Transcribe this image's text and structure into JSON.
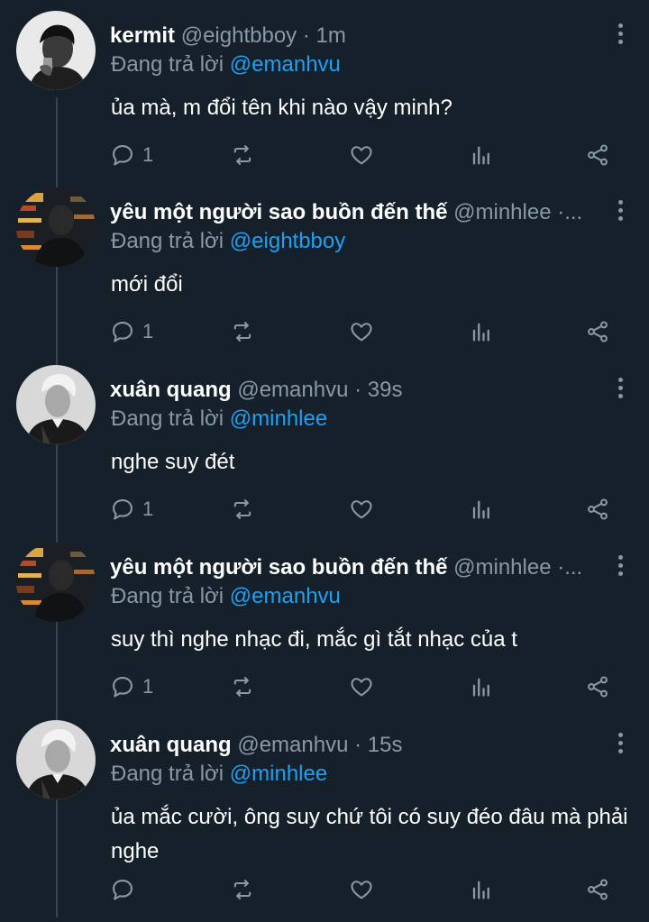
{
  "colors": {
    "background": "#15202b",
    "secondary_text": "#8899a6",
    "mention": "#1da1f2",
    "thread_line": "#38444d"
  },
  "replying_prefix": "Đang trả lời",
  "tweets": [
    {
      "name": "kermit",
      "handle": "@eightbboy",
      "time": "· 1m",
      "reply_to": "@emanhvu",
      "text": "ủa mà, m đổi tên khi nào vậy minh?",
      "reply_count": "1",
      "avatar_icon": "profile-photo-man-drinking"
    },
    {
      "name": "yêu một người sao buồn đến thế",
      "handle": "@minhlee",
      "time": "·...",
      "reply_to": "@eightbboy",
      "text": "mới đổi",
      "reply_count": "1",
      "avatar_icon": "profile-photo-night-lights"
    },
    {
      "name": "xuân quang",
      "handle": "@emanhvu",
      "time": "· 39s",
      "reply_to": "@minhlee",
      "text": "nghe suy đét",
      "reply_count": "1",
      "avatar_icon": "profile-photo-man-suit"
    },
    {
      "name": "yêu một người sao buồn đến thế",
      "handle": "@minhlee",
      "time": "·...",
      "reply_to": "@emanhvu",
      "text": "suy thì nghe nhạc đi, mắc gì tắt nhạc của t",
      "reply_count": "1",
      "avatar_icon": "profile-photo-night-lights"
    },
    {
      "name": "xuân quang",
      "handle": "@emanhvu",
      "time": "· 15s",
      "reply_to": "@minhlee",
      "text": "ủa mắc cười, ông suy chứ tôi có suy đéo đâu mà phải nghe",
      "reply_count": "",
      "avatar_icon": "profile-photo-man-suit"
    }
  ]
}
